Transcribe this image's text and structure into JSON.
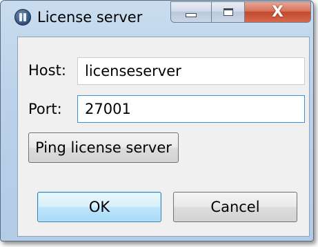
{
  "window": {
    "title": "License server",
    "icon": "app-icon",
    "controls": {
      "minimize_icon": "minimize-icon",
      "maximize_icon": "maximize-icon",
      "close_glyph": "X"
    }
  },
  "form": {
    "host_label": "Host:",
    "host_value": "licenseserver",
    "port_label": "Port:",
    "port_value": "27001"
  },
  "buttons": {
    "ping_label": "Ping license server",
    "ok_label": "OK",
    "cancel_label": "Cancel"
  },
  "colors": {
    "titlebar": "#bcd2ea",
    "close_button": "#c24a2f",
    "focus_border": "#3d8fd6",
    "default_button": "#bee6fd"
  }
}
